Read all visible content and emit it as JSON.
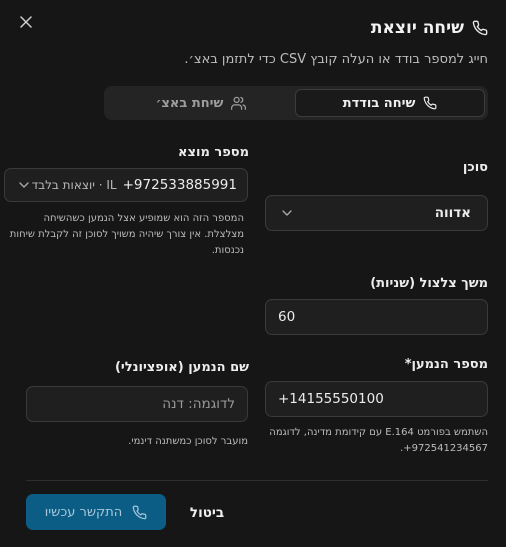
{
  "header": {
    "title": "שיחה יוצאת",
    "subtitle": "חייג למספר בודד או העלה קובץ CSV כדי לתזמן באצ׳."
  },
  "tabs": [
    {
      "label": "שיחה בודדת",
      "icon": "phone-icon",
      "active": true
    },
    {
      "label": "שיחת באצ׳",
      "icon": "users-icon",
      "active": false
    }
  ],
  "caller_id": {
    "label": "מספר מוצא",
    "number": "+972533885991",
    "tag": "IL · יוצאות בלבד",
    "help": "המספר הזה הוא שמופיע אצל הנמען כשהשיחה מצלצלת. אין צורך שיהיה משויך לסוכן זה לקבלת שיחות נכנסות."
  },
  "agent": {
    "label": "סוכן",
    "value": "אדווה"
  },
  "ring_duration": {
    "label": "משך צלצול (שניות)",
    "value": "60"
  },
  "recipient_name": {
    "label": "שם הנמען (אופציונלי)",
    "placeholder": "לדוגמה: דנה",
    "help": "מועבר לסוכן כמשתנה דינמי."
  },
  "recipient_number": {
    "label": "מספר הנמען*",
    "value": "+14155550100",
    "help": "השתמש בפורמט E.164 עם קידומת מדינה, לדוגמה ‎+972541234567."
  },
  "footer": {
    "cancel_label": "ביטול",
    "call_label": "התקשר עכשיו"
  },
  "colors": {
    "background": "#161616",
    "primary_button": "#0b5d86"
  }
}
